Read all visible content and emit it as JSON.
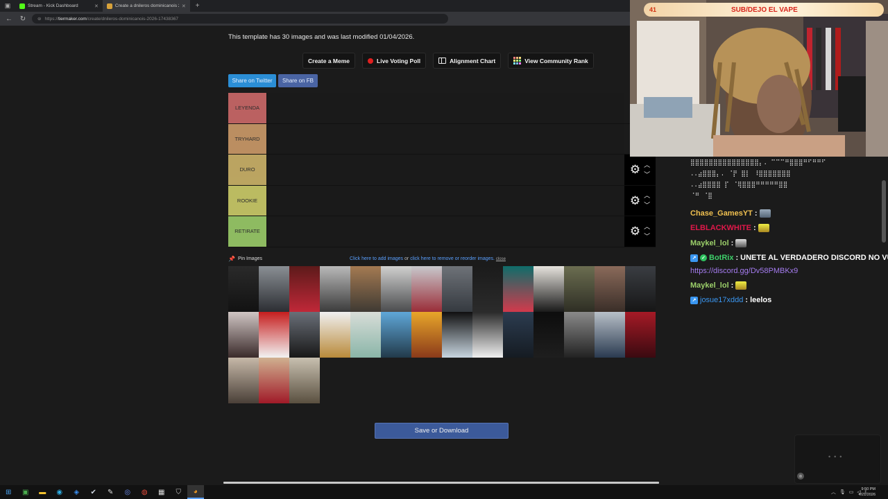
{
  "browser": {
    "tabs": [
      {
        "title": "Stream - Kick Dashboard",
        "favicon_color": "#53fc18"
      },
      {
        "title": "Create a dnileros dominicanois 20",
        "favicon_color": "#d8a23a"
      }
    ],
    "address": {
      "domain": "tiermaker.com",
      "path": "/create/dnileros-dominicanois-2026-17438367"
    }
  },
  "page": {
    "template_info": "This template has 30 images and was last modified 01/04/2026.",
    "toolbar": {
      "meme": "Create a Meme",
      "poll": "Live Voting Poll",
      "alignment": "Alignment Chart",
      "rank": "View Community Rank"
    },
    "share": {
      "twitter": "Share on Twitter",
      "facebook": "Share on FB"
    },
    "tiers": [
      {
        "label": "LEYENDA",
        "color": "#ff7f7f"
      },
      {
        "label": "TRYHARD",
        "color": "#ffbf7f"
      },
      {
        "label": "DURO",
        "color": "#ffdf7f"
      },
      {
        "label": "ROOKIE",
        "color": "#ffff7f"
      },
      {
        "label": "RETIRATE",
        "color": "#bfff7f"
      }
    ],
    "pin_images": "Pin Images",
    "add_images_link": "Click here to add images",
    "or_text": "or",
    "reorder_link": "click here to remove or reorder images.",
    "close_link": "close",
    "save_button": "Save or Download"
  },
  "stream": {
    "banner_count": "41",
    "banner_text": "SUB/DEJO EL VAPE"
  },
  "chat": {
    "messages": [
      {
        "user": "Chase_GamesYT",
        "sep": " :"
      },
      {
        "user": "ELBLACKWHITE",
        "sep": " :"
      },
      {
        "user": "Maykel_lol",
        "sep": " :"
      },
      {
        "user": "BotRix",
        "sep": " :",
        "text": "UNETE AL VERDADERO DISCORD NO VU"
      },
      {
        "link": "https://discord.gg/Dv58PMBKx9"
      },
      {
        "user": "Maykel_lol",
        "sep": " :"
      },
      {
        "user": "josue17xddd",
        "sep": " :",
        "text": "leelos"
      }
    ]
  },
  "taskbar": {
    "clock_time": "9:50 PM",
    "clock_date": "4/21/2026"
  }
}
